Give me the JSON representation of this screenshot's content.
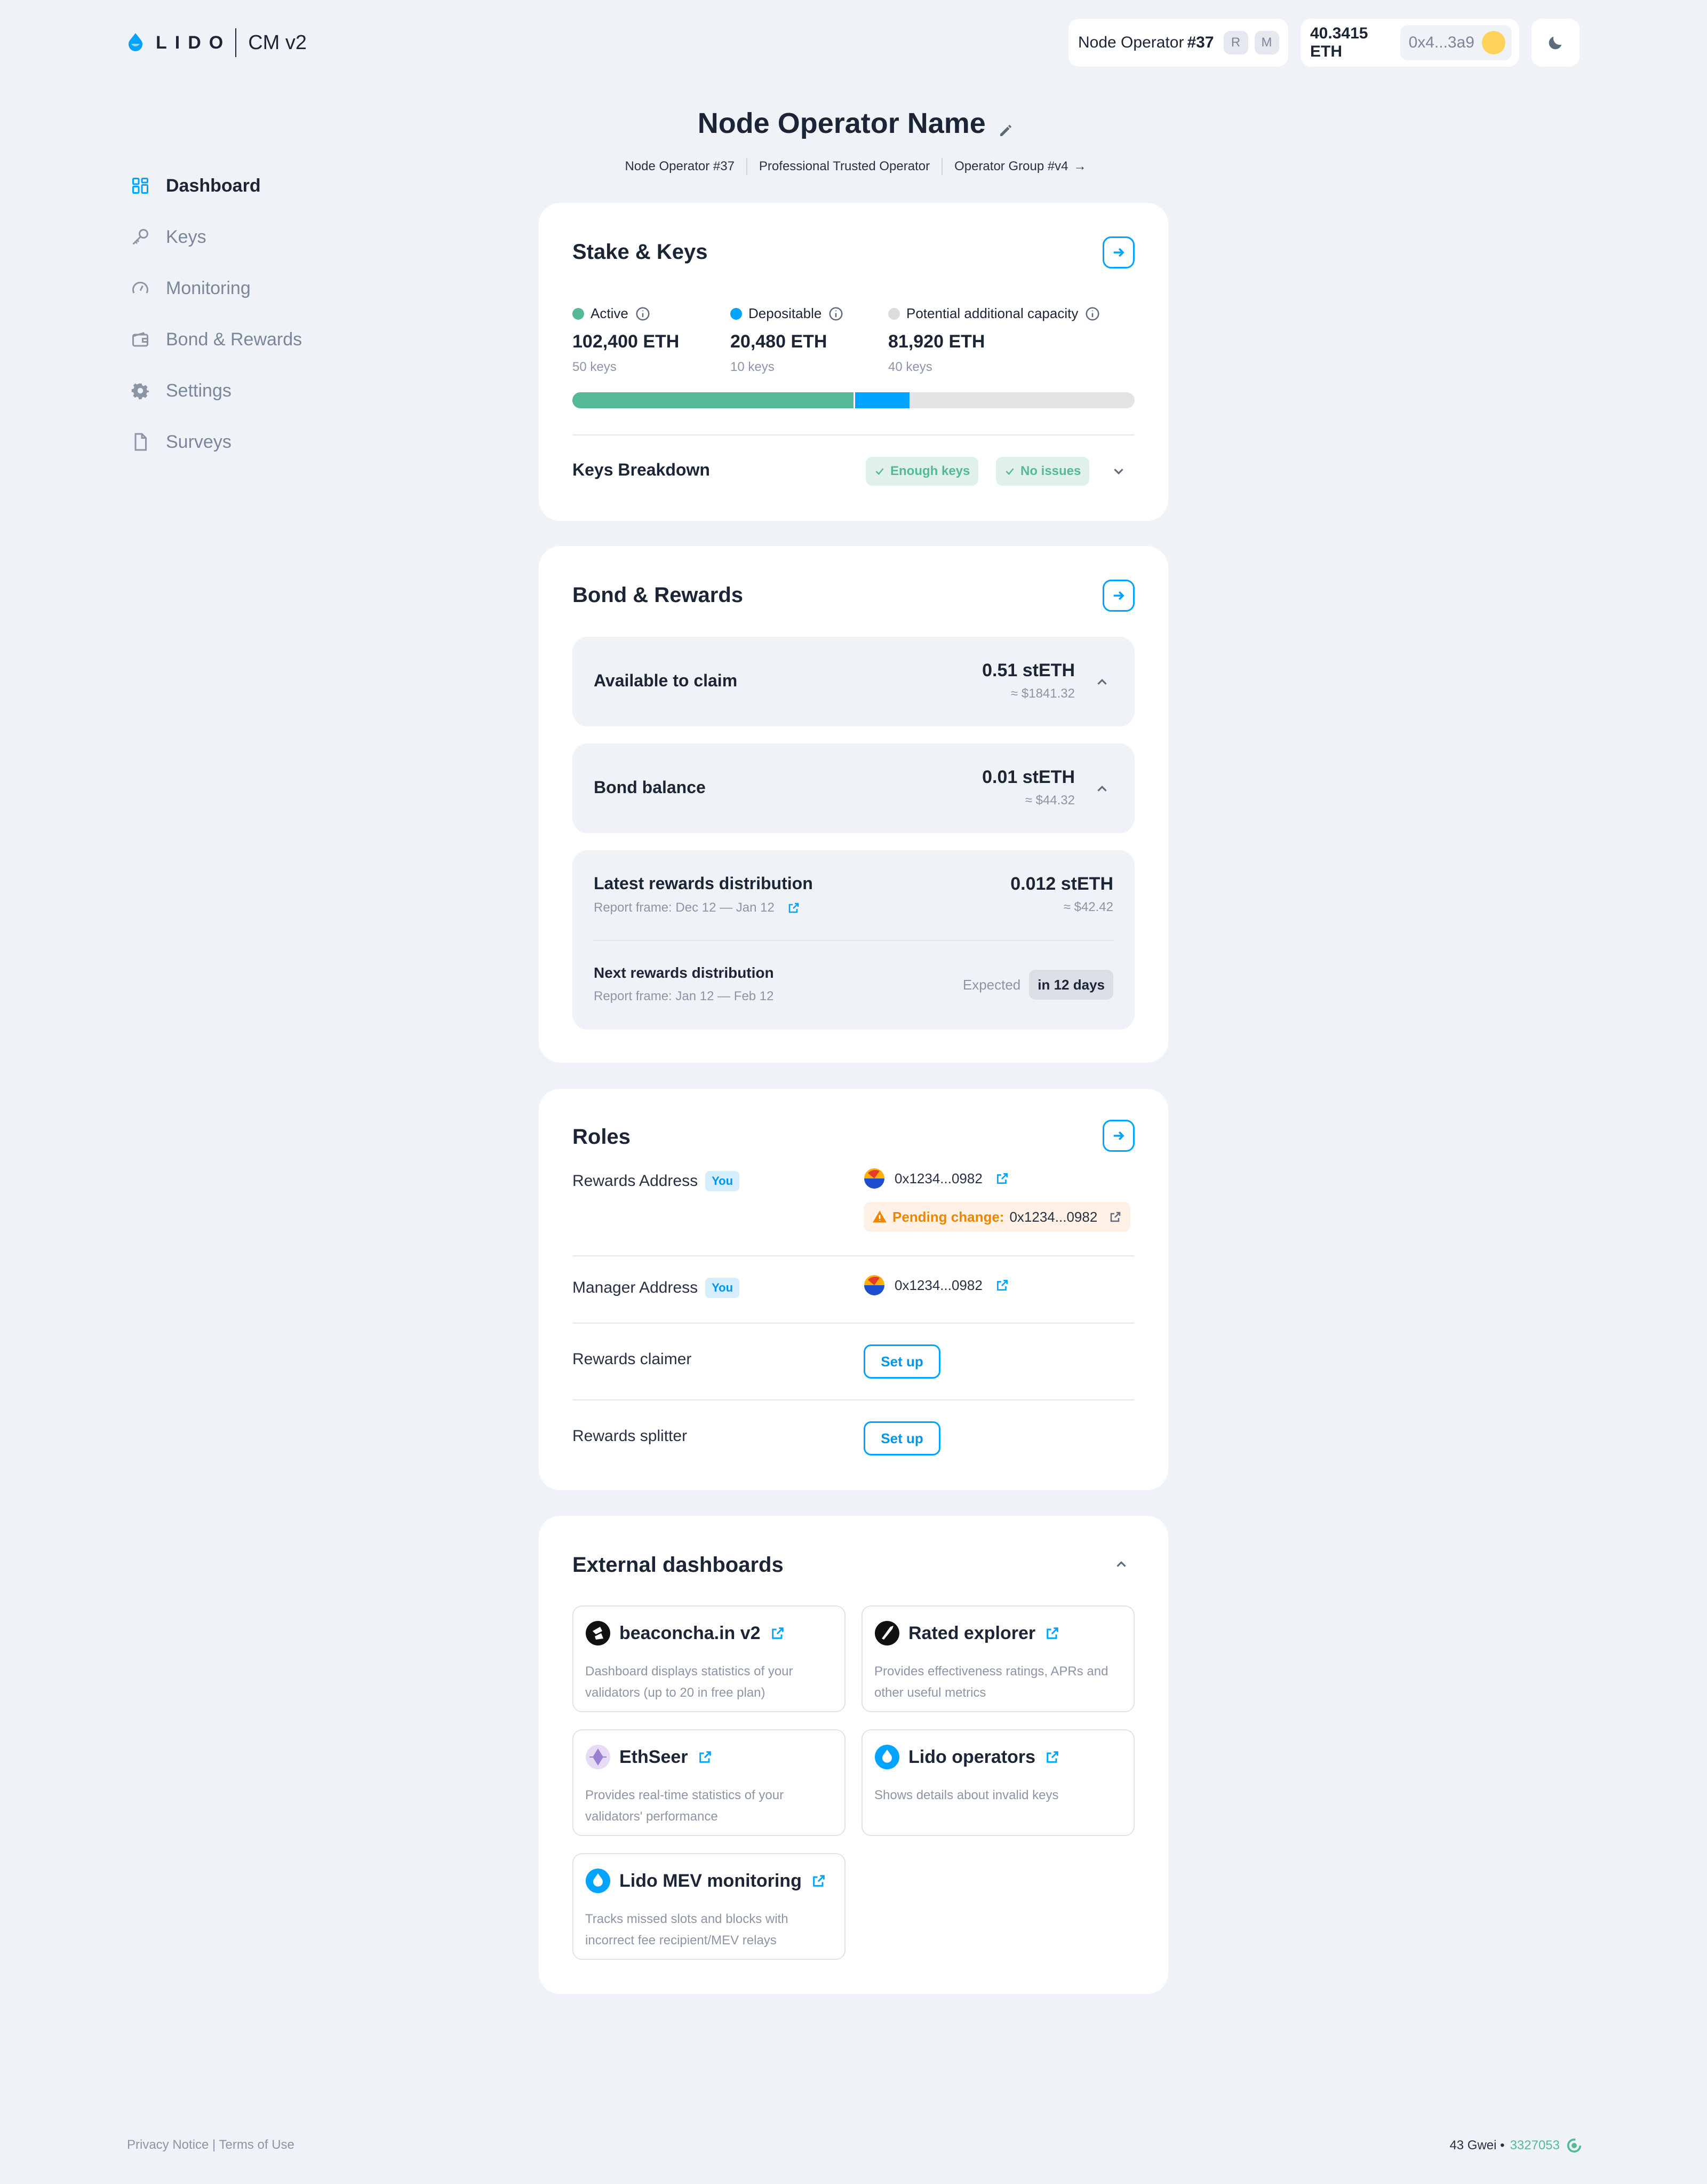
{
  "app": {
    "wordmark": "LIDO",
    "version": "CM v2"
  },
  "header": {
    "operator_label": "Node Operator",
    "operator_number": "#37",
    "role_badges": [
      "R",
      "M"
    ],
    "balance": "40.3415 ETH",
    "address": "0x4...3a9",
    "theme_icon": "moon-icon"
  },
  "sidebar": {
    "items": [
      {
        "label": "Dashboard",
        "icon": "dashboard-icon",
        "active": true
      },
      {
        "label": "Keys",
        "icon": "key-icon",
        "active": false
      },
      {
        "label": "Monitoring",
        "icon": "gauge-icon",
        "active": false
      },
      {
        "label": "Bond & Rewards",
        "icon": "wallet-icon",
        "active": false
      },
      {
        "label": "Settings",
        "icon": "gear-icon",
        "active": false
      },
      {
        "label": "Surveys",
        "icon": "document-icon",
        "active": false
      }
    ]
  },
  "page": {
    "title": "Node Operator Name",
    "breadcrumbs": [
      "Node Operator #37",
      "Professional Trusted Operator",
      "Operator Group #v4"
    ]
  },
  "stake": {
    "title": "Stake & Keys",
    "stats": [
      {
        "label": "Active",
        "value": "102,400 ETH",
        "keys": "50 keys",
        "color": "#53ba95"
      },
      {
        "label": "Depositable",
        "value": "20,480 ETH",
        "keys": "10 keys",
        "color": "#00a3ff"
      },
      {
        "label": "Potential additional capacity",
        "value": "81,920 ETH",
        "keys": "40 keys",
        "color": "#dcdcdc"
      }
    ],
    "breakdown_label": "Keys Breakdown",
    "badges": [
      "Enough keys",
      "No issues"
    ]
  },
  "bond": {
    "title": "Bond & Rewards",
    "available": {
      "label": "Available to claim",
      "value": "0.51 stETH",
      "usd": "≈ $1841.32"
    },
    "balance": {
      "label": "Bond balance",
      "value": "0.01 stETH",
      "usd": "≈ $44.32"
    },
    "latest": {
      "label": "Latest rewards distribution",
      "frame": "Report frame: Dec 12  — Jan 12",
      "value": "0.012 stETH",
      "usd": "≈ $42.42"
    },
    "next": {
      "label": "Next rewards distribution",
      "frame": "Report frame: Jan 12  — Feb 12",
      "expected_label": "Expected",
      "expected_value": "in 12 days"
    }
  },
  "roles": {
    "title": "Roles",
    "you_label": "You",
    "rewards_address": {
      "label": "Rewards Address",
      "address": "0x1234...0982",
      "pending_label": "Pending change:",
      "pending_address": "0x1234...0982"
    },
    "manager_address": {
      "label": "Manager Address",
      "address": "0x1234...0982"
    },
    "rewards_claimer": {
      "label": "Rewards claimer",
      "button": "Set up"
    },
    "rewards_splitter": {
      "label": "Rewards splitter",
      "button": "Set up"
    }
  },
  "external": {
    "title": "External dashboards",
    "items": [
      {
        "name": "beaconcha.in v2",
        "desc": "Dashboard displays statistics of your validators (up to 20 in free plan)",
        "icon": "beaconchain-icon"
      },
      {
        "name": "Rated explorer",
        "desc": "Provides effectiveness ratings, APRs and other useful metrics",
        "icon": "rated-icon"
      },
      {
        "name": "EthSeer",
        "desc": "Provides real-time statistics of your validators' performance",
        "icon": "ethseer-icon"
      },
      {
        "name": "Lido operators",
        "desc": "Shows details about invalid keys",
        "icon": "lido-icon"
      },
      {
        "name": "Lido MEV monitoring",
        "desc": "Tracks missed slots and blocks with incorrect fee recipient/MEV relays",
        "icon": "lido-icon"
      }
    ]
  },
  "footer": {
    "links": "Privacy Notice | Terms of Use",
    "gas": "43 Gwei •",
    "block": "3327053"
  },
  "colors": {
    "accent": "#00a3ff",
    "active": "#53ba95",
    "warning": "#ec8600",
    "background": "#eff2f6"
  }
}
